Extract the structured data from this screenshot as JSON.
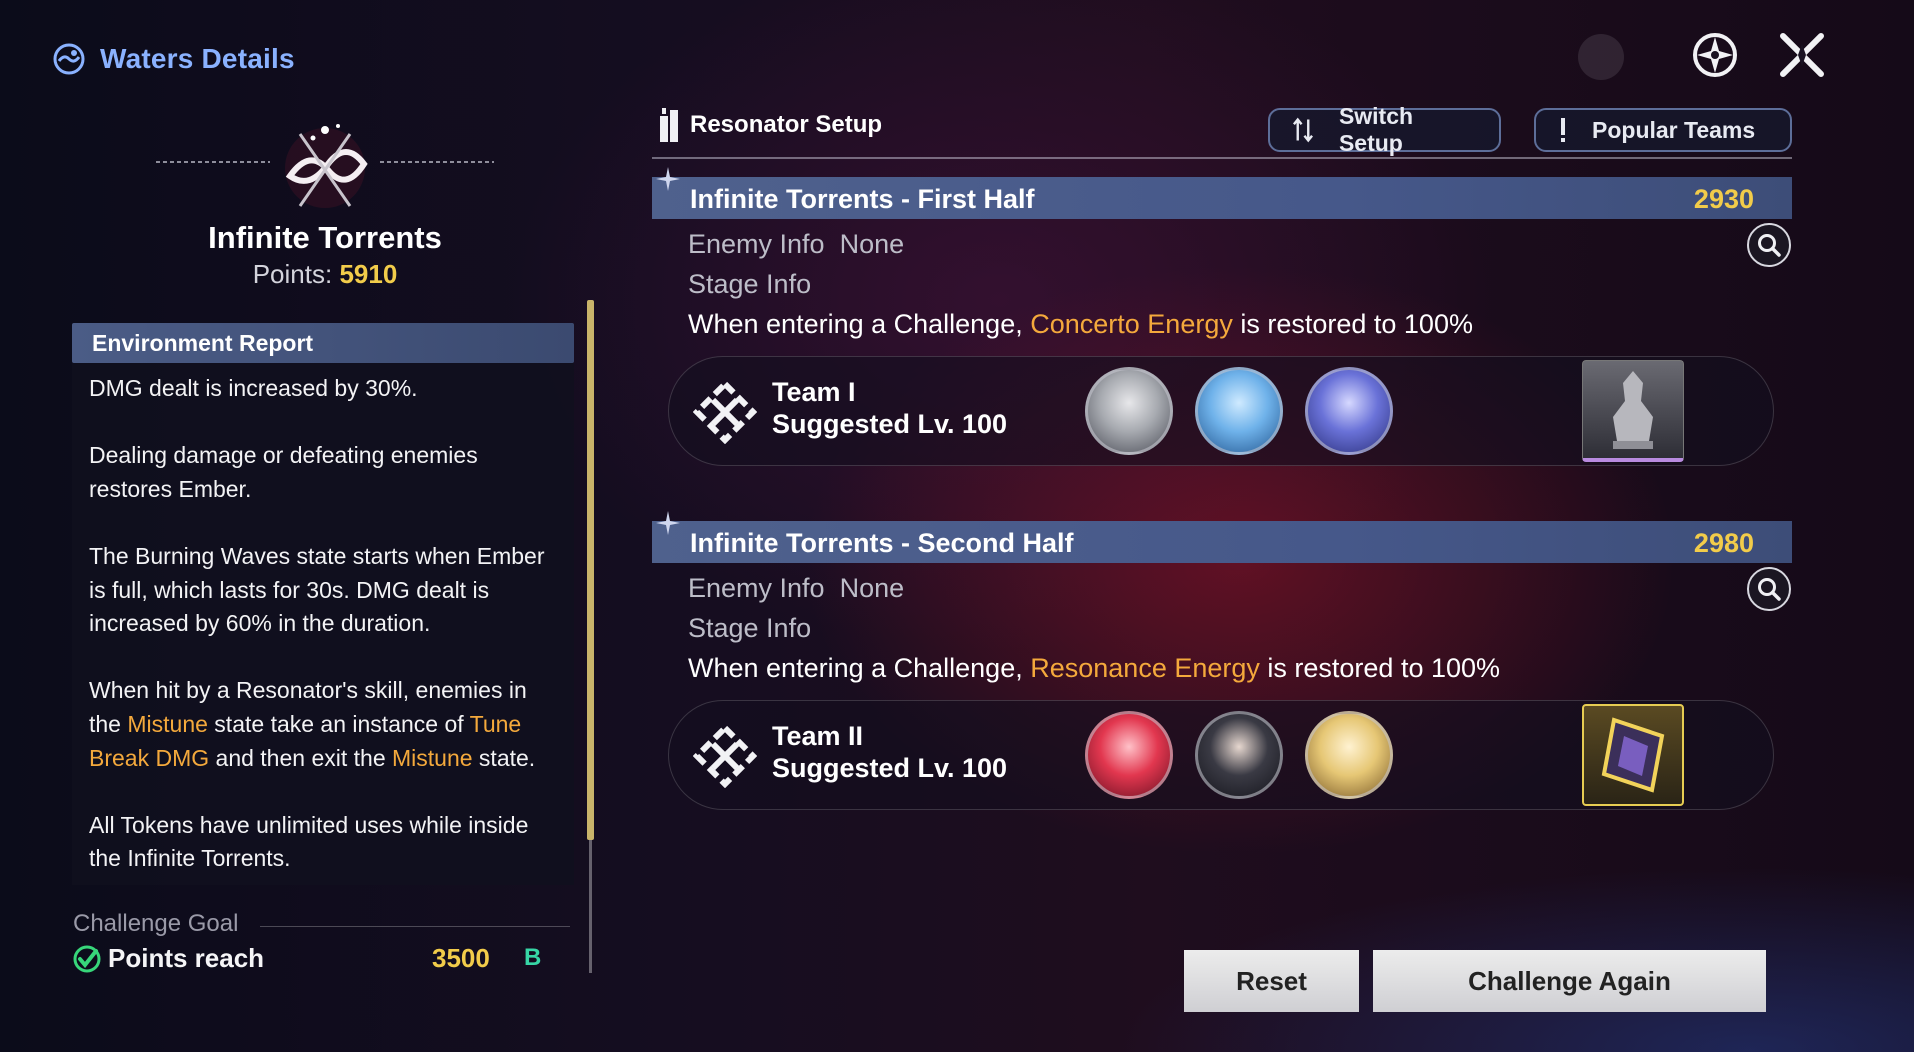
{
  "window": {
    "title": "Waters Details"
  },
  "level": {
    "name": "Infinite Torrents",
    "points_label": "Points: ",
    "points_value": "5910"
  },
  "environment": {
    "header": "Environment Report",
    "para1": "DMG dealt is increased by 30%.",
    "para2": "Dealing damage or defeating enemies restores Ember.",
    "para3": "The Burning Waves state starts when Ember is full, which lasts for 30s. DMG dealt is increased by 60% in the duration.",
    "para4_a": "When hit by a Resonator's skill, enemies in the ",
    "para4_b": "Mistune",
    "para4_c": " state take an instance of ",
    "para4_d": "Tune Break DMG",
    "para4_e": " and then exit the ",
    "para4_f": "Mistune",
    "para4_g": " state.",
    "para5": "All Tokens have unlimited uses while inside the Infinite Torrents."
  },
  "goal": {
    "label": "Challenge Goal",
    "text": "Points reach",
    "value": "3500",
    "badge": "B"
  },
  "setup": {
    "label": "Resonator Setup",
    "switch_label": "Switch Setup",
    "popular_label": "Popular Teams"
  },
  "stages": [
    {
      "name": "Infinite Torrents - First Half",
      "score": "2930",
      "enemy_label": "Enemy Info",
      "enemy_value": "None",
      "stage_label": "Stage Info",
      "desc_a": "When entering a Challenge, ",
      "desc_hl": "Concerto Energy",
      "desc_b": " is restored to 100%",
      "team_name": "Team I",
      "team_level": "Suggested Lv. 100"
    },
    {
      "name": "Infinite Torrents - Second Half",
      "score": "2980",
      "enemy_label": "Enemy Info",
      "enemy_value": "None",
      "stage_label": "Stage Info",
      "desc_a": "When entering a Challenge, ",
      "desc_hl": "Resonance Energy",
      "desc_b": " is restored to 100%",
      "team_name": "Team II",
      "team_level": "Suggested Lv. 100"
    }
  ],
  "buttons": {
    "reset": "Reset",
    "challenge_again": "Challenge Again"
  },
  "colors": {
    "accent_blue": "#8ab2ff",
    "gold": "#f2cc4a",
    "orange_highlight": "#f4a93c",
    "goal_badge": "#37d6a6"
  },
  "icons": [
    "waters-icon",
    "settings-icon",
    "close-icon",
    "resonator-icon",
    "switch-icon",
    "exclamation-icon",
    "search-icon",
    "team-icon",
    "check-icon"
  ]
}
